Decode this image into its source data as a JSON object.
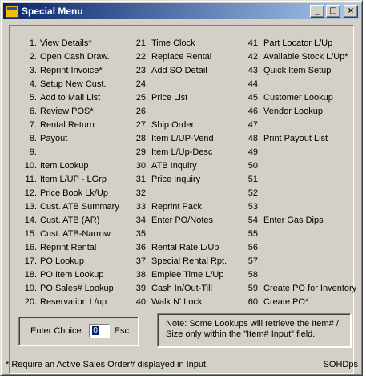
{
  "window": {
    "title": "Special Menu",
    "minimize_label": "_",
    "maximize_label": "□",
    "close_label": "×"
  },
  "menu": {
    "col1": [
      {
        "num": "1.",
        "label": "View Details*"
      },
      {
        "num": "2.",
        "label": "Open Cash Draw."
      },
      {
        "num": "3.",
        "label": "Reprint Invoice*"
      },
      {
        "num": "4.",
        "label": "Setup New Cust."
      },
      {
        "num": "5.",
        "label": "Add to Mail List"
      },
      {
        "num": "6.",
        "label": "Review POS*"
      },
      {
        "num": "7.",
        "label": "Rental Return"
      },
      {
        "num": "8.",
        "label": "Payout"
      },
      {
        "num": "9.",
        "label": ""
      },
      {
        "num": "10.",
        "label": "Item Lookup"
      },
      {
        "num": "11.",
        "label": "Item L/UP - LGrp"
      },
      {
        "num": "12.",
        "label": "Price Book Lk/Up"
      },
      {
        "num": "13.",
        "label": "Cust. ATB Summary"
      },
      {
        "num": "14.",
        "label": "Cust. ATB (AR)"
      },
      {
        "num": "15.",
        "label": "Cust. ATB-Narrow"
      },
      {
        "num": "16.",
        "label": "Reprint Rental"
      },
      {
        "num": "17.",
        "label": "PO Lookup"
      },
      {
        "num": "18.",
        "label": "PO Item Lookup"
      },
      {
        "num": "19.",
        "label": "PO Sales# Lookup"
      },
      {
        "num": "20.",
        "label": "Reservation L/up"
      }
    ],
    "col2": [
      {
        "num": "21.",
        "label": "Time Clock"
      },
      {
        "num": "22.",
        "label": "Replace Rental"
      },
      {
        "num": "23.",
        "label": "Add SO Detail"
      },
      {
        "num": "24.",
        "label": ""
      },
      {
        "num": "25.",
        "label": "Price List"
      },
      {
        "num": "26.",
        "label": ""
      },
      {
        "num": "27.",
        "label": "Ship Order"
      },
      {
        "num": "28.",
        "label": "Item L/UP-Vend"
      },
      {
        "num": "29.",
        "label": "Item L/Up-Desc"
      },
      {
        "num": "30.",
        "label": "ATB Inquiry"
      },
      {
        "num": "31.",
        "label": "Price Inquiry"
      },
      {
        "num": "32.",
        "label": ""
      },
      {
        "num": "33.",
        "label": "Reprint Pack"
      },
      {
        "num": "34.",
        "label": "Enter PO/Notes"
      },
      {
        "num": "35.",
        "label": ""
      },
      {
        "num": "36.",
        "label": "Rental Rate L/Up"
      },
      {
        "num": "37.",
        "label": "Special Rental Rpt."
      },
      {
        "num": "38.",
        "label": "Emplee Time L/Up"
      },
      {
        "num": "39.",
        "label": "Cash In/Out-Till"
      },
      {
        "num": "40.",
        "label": "Walk N' Lock"
      }
    ],
    "col3": [
      {
        "num": "41.",
        "label": "Part Locator L/Up"
      },
      {
        "num": "42.",
        "label": "Available Stock L/Up*"
      },
      {
        "num": "43.",
        "label": "Quick Item Setup"
      },
      {
        "num": "44.",
        "label": ""
      },
      {
        "num": "45.",
        "label": "Customer Lookup"
      },
      {
        "num": "46.",
        "label": "Vendor Lookup"
      },
      {
        "num": "47.",
        "label": ""
      },
      {
        "num": "48.",
        "label": "Print Payout List"
      },
      {
        "num": "49.",
        "label": ""
      },
      {
        "num": "50.",
        "label": ""
      },
      {
        "num": "51.",
        "label": ""
      },
      {
        "num": "52.",
        "label": ""
      },
      {
        "num": "53.",
        "label": ""
      },
      {
        "num": "54.",
        "label": "Enter Gas Dips"
      },
      {
        "num": "55.",
        "label": ""
      },
      {
        "num": "56.",
        "label": ""
      },
      {
        "num": "57.",
        "label": ""
      },
      {
        "num": "58.",
        "label": ""
      },
      {
        "num": "59.",
        "label": "Create PO for Inventory"
      },
      {
        "num": "60.",
        "label": "Create PO*"
      }
    ]
  },
  "choice": {
    "label": "Enter Choice:",
    "value": "0",
    "esc_label": "Esc"
  },
  "note": {
    "text": "Note: Some Lookups will retrieve the Item# / Size only within the \"Item# Input\" field."
  },
  "footer": {
    "footnote": "* Require an Active Sales Order# displayed in Input.",
    "code": "SOHDps"
  }
}
